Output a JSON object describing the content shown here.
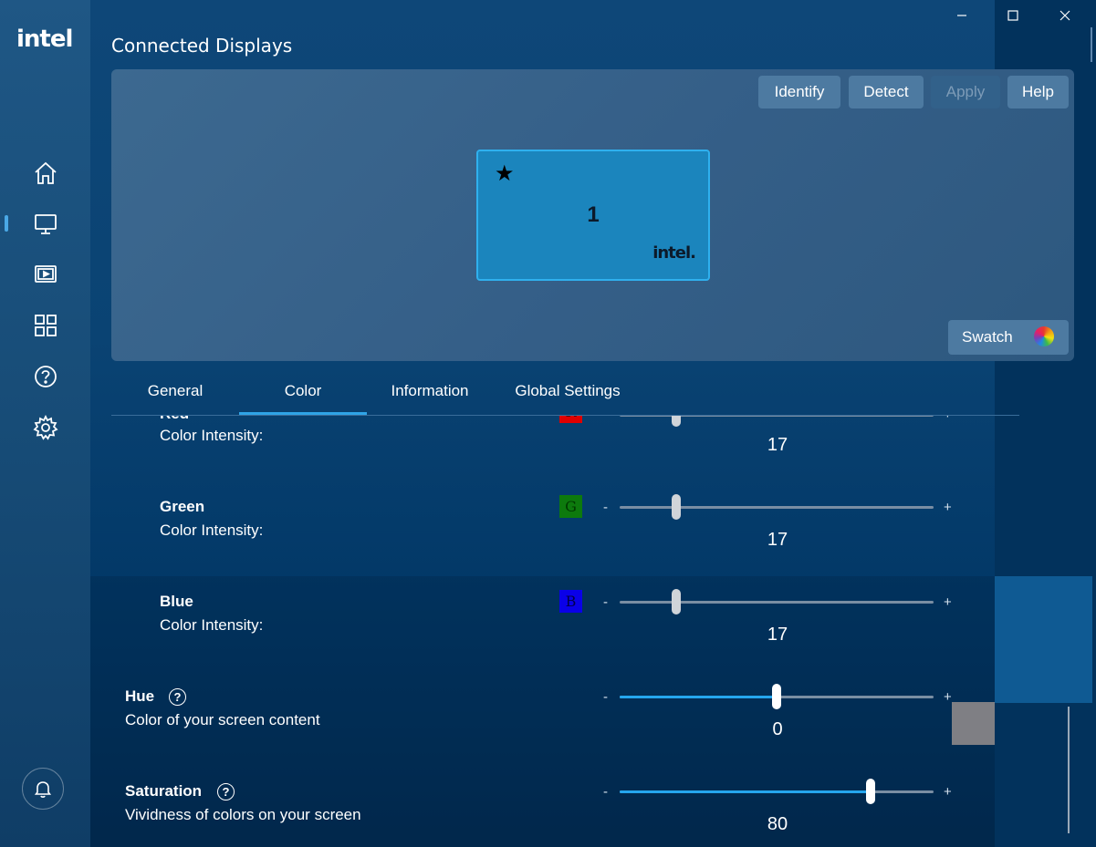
{
  "app": {
    "logo": "intel",
    "title": "Connected Displays"
  },
  "window": {
    "minimize": "—",
    "maximize": "☐",
    "close": "✕"
  },
  "sidebar": {
    "items": [
      {
        "name": "home",
        "icon": "home-icon"
      },
      {
        "name": "display",
        "icon": "monitor-icon",
        "active": true
      },
      {
        "name": "video",
        "icon": "video-icon"
      },
      {
        "name": "apps",
        "icon": "grid-icon"
      },
      {
        "name": "help",
        "icon": "help-icon"
      },
      {
        "name": "settings",
        "icon": "gear-icon"
      }
    ],
    "bell_icon": "bell-icon"
  },
  "display_panel": {
    "buttons": {
      "identify": "Identify",
      "detect": "Detect",
      "apply": "Apply",
      "help": "Help"
    },
    "monitor": {
      "star": "★",
      "number": "1",
      "brand": "intel."
    },
    "swatch_label": "Swatch"
  },
  "tabs": [
    "General",
    "Color",
    "Information",
    "Global Settings"
  ],
  "active_tab": "Color",
  "color": {
    "red": {
      "label": "Red",
      "intensity_label": "Color Intensity:",
      "chip": "R",
      "value": "17",
      "level": 0.18
    },
    "green": {
      "label": "Green",
      "intensity_label": "Color Intensity:",
      "chip": "G",
      "value": "17",
      "level": 0.18
    },
    "blue": {
      "label": "Blue",
      "intensity_label": "Color Intensity:",
      "chip": "B",
      "value": "17",
      "level": 0.18
    },
    "hue": {
      "label": "Hue",
      "desc": "Color of your screen content",
      "value": "0",
      "level": 0.5
    },
    "saturation": {
      "label": "Saturation",
      "desc": "Vividness of colors on your screen",
      "value": "80",
      "level": 0.8
    },
    "minus": "-",
    "plus": "+",
    "help_glyph": "?"
  },
  "colors": {
    "accent": "#2fa4e7",
    "red_chip": "#e00000",
    "green_chip": "#0d7a0d",
    "blue_chip": "#0a00e8"
  }
}
